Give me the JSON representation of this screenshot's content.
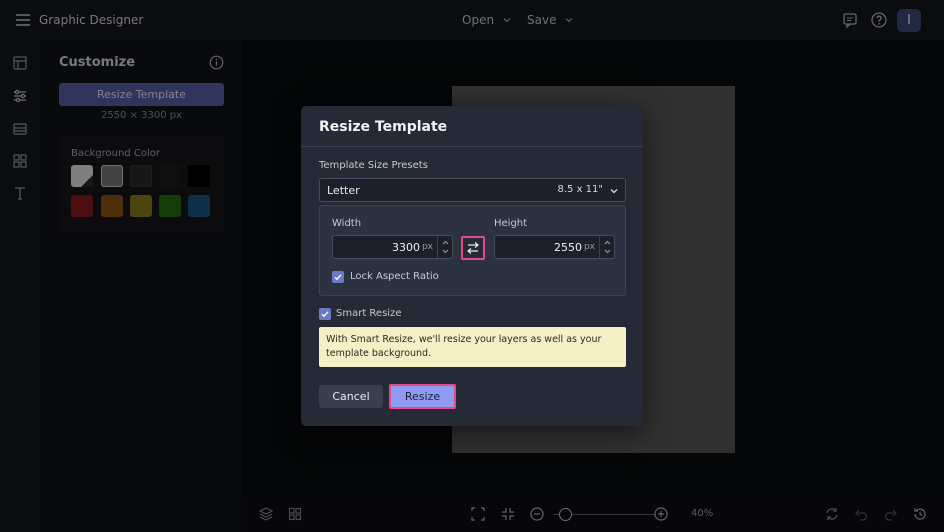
{
  "app": {
    "title": "Graphic Designer",
    "menu": [
      {
        "label": "Open",
        "icon": "chevron-down-icon"
      },
      {
        "label": "Save",
        "icon": "chevron-down-icon"
      }
    ],
    "avatar_initial": "I"
  },
  "sidebar": {
    "title": "Customize",
    "resize_button": "Resize Template",
    "dimensions": "2550 × 3300 px",
    "background_color_label": "Background Color",
    "swatches": [
      "#e8e8e8",
      "#7a7a7a",
      "#2a2a2a",
      "#1d1d1d",
      "#000000",
      "#d42f2f",
      "#d9811e",
      "#d6c72b",
      "#3fa71d",
      "#2c83d2"
    ]
  },
  "bottom": {
    "zoom_label": "40%"
  },
  "modal": {
    "title": "Resize Template",
    "preset_label": "Template Size Presets",
    "preset_name": "Letter",
    "preset_size": "8.5 x 11\"",
    "width_label": "Width",
    "width_value": "3300",
    "height_label": "Height",
    "height_value": "2550",
    "unit": "px",
    "lock_label": "Lock Aspect Ratio",
    "lock_checked": true,
    "smart_resize_label": "Smart Resize",
    "smart_resize_checked": true,
    "notice": "With Smart Resize, we'll resize your layers as well as your template background.",
    "cancel_label": "Cancel",
    "resize_label": "Resize"
  },
  "colors": {
    "accent": "#5661a8",
    "highlight": "#e64a86",
    "primary_button": "#8f9bf3",
    "notice_bg": "#f4efc4"
  }
}
